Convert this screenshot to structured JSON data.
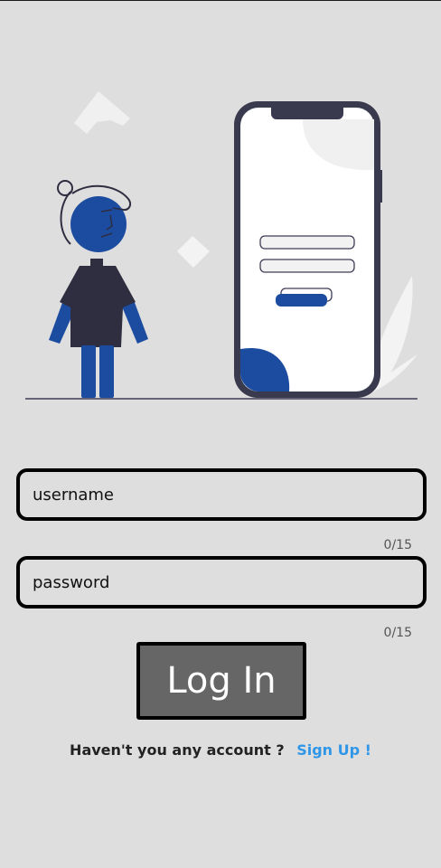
{
  "login_form": {
    "username": {
      "placeholder": "username",
      "counter": "0/15"
    },
    "password": {
      "placeholder": "password",
      "counter": "0/15"
    },
    "login_button_label": "Log In"
  },
  "signup": {
    "prompt": "Haven't you any account ?",
    "link_label": "Sign Up !"
  },
  "illustration": {
    "name": "person-with-phone-login-illustration",
    "colors": {
      "accent_blue": "#1c4ca0",
      "dark_navy": "#2f2e41",
      "phone_screen": "#ffffff",
      "background": "#dedede"
    }
  }
}
